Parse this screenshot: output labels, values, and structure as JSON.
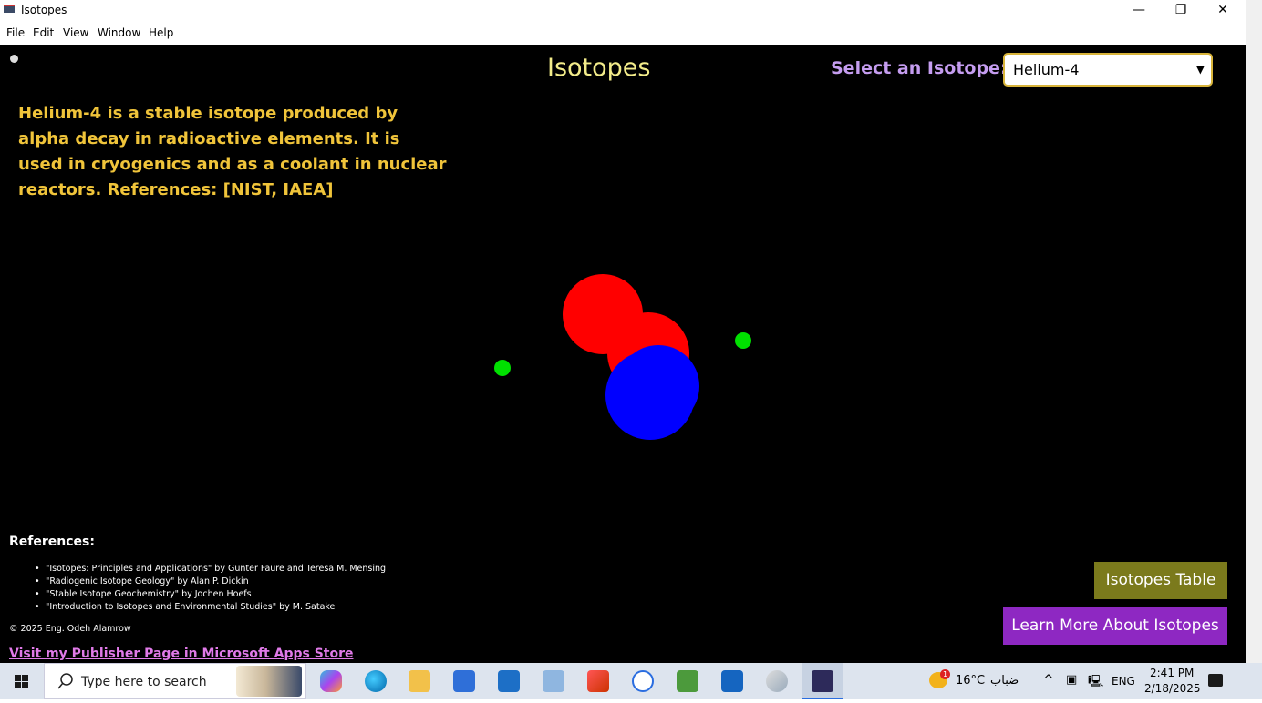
{
  "window": {
    "title": "Isotopes",
    "minimize_glyph": "—",
    "maximize_glyph": "❐",
    "close_glyph": "✕"
  },
  "menu": [
    "File",
    "Edit",
    "View",
    "Window",
    "Help"
  ],
  "app": {
    "title": "Isotopes",
    "select_label": "Select an Isotope:",
    "selected_isotope": "Helium-4",
    "description": "Helium-4 is a stable isotope produced by alpha decay in radioactive elements. It is used in cryogenics and as a coolant in nuclear reactors. References: [NIST, IAEA]",
    "references_heading": "References:",
    "references": [
      "\"Isotopes: Principles and Applications\" by Gunter Faure and Teresa M. Mensing",
      "\"Radiogenic Isotope Geology\" by Alan P. Dickin",
      "\"Stable Isotope Geochemistry\" by Jochen Hoefs",
      "\"Introduction to Isotopes and Environmental Studies\" by M. Satake"
    ],
    "copyright": "© 2025 Eng. Odeh Alamrow",
    "publisher_link": "Visit my Publisher Page in Microsoft Apps Store",
    "table_button": "Isotopes Table",
    "learn_button": "Learn More About Isotopes",
    "colors": {
      "proton": "#ff0000",
      "neutron": "#0000ff",
      "electron": "#00e000"
    }
  },
  "taskbar": {
    "search_placeholder": "Type here to search",
    "weather_temp": "16°C",
    "weather_desc": "ضباب",
    "weather_badge": "1",
    "language": "ENG",
    "time": "2:41 PM",
    "date": "2/18/2025"
  }
}
